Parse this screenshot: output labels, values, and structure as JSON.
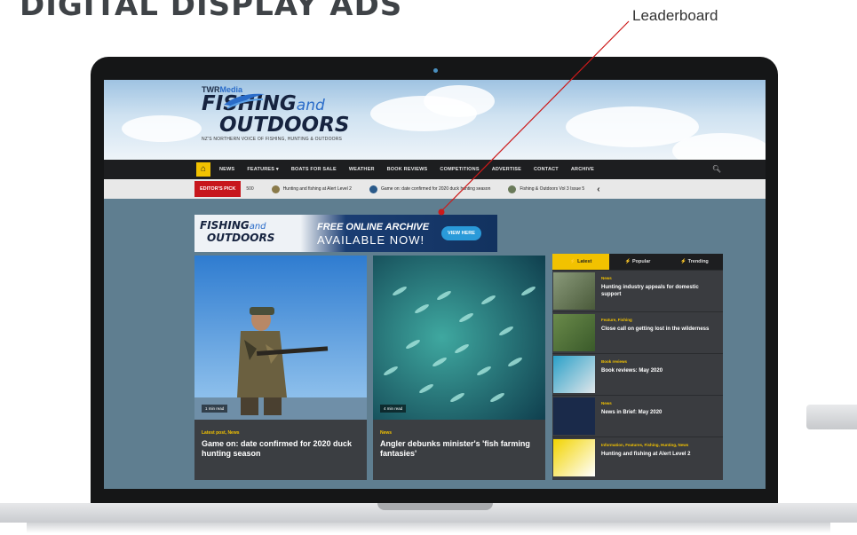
{
  "page": {
    "heading": "DIGITAL DISPLAY ADS",
    "callout_label": "Leaderboard"
  },
  "site": {
    "brand_top": "TWR",
    "brand_top_accent": "Media",
    "logo_line1": "FISHING",
    "logo_and": "and",
    "logo_line2": "OUTDOORS",
    "tagline": "NZ'S NORTHERN VOICE OF FISHING, HUNTING & OUTDOORS"
  },
  "nav": {
    "items": [
      "NEWS",
      "FEATURES ▾",
      "BOATS FOR SALE",
      "WEATHER",
      "BOOK REVIEWS",
      "COMPETITIONS",
      "ADVERTISE",
      "CONTACT",
      "ARCHIVE"
    ],
    "home_icon": "home-icon",
    "search_icon": "search-icon"
  },
  "ticker": {
    "pick_label": "EDITOR'S PICK",
    "tag": "500",
    "items": [
      "Hunting and fishing at Alert Level 2",
      "Game on: date confirmed for 2020 duck hunting season",
      "Fishing & Outdoors Vol 3 Issue 5"
    ]
  },
  "leaderboard": {
    "logo_line1": "FISHING",
    "logo_and": "and",
    "logo_line2": "OUTDOORS",
    "title": "FREE ONLINE ARCHIVE",
    "subtitle": "AVAILABLE NOW!",
    "button": "VIEW HERE"
  },
  "cards": [
    {
      "category": "Latest post, News",
      "title": "Game on: date confirmed for 2020 duck hunting season",
      "read_time": "1 min read"
    },
    {
      "category": "News",
      "title": "Angler debunks minister's 'fish farming fantasies'",
      "read_time": "4 min read"
    }
  ],
  "sidebar": {
    "tabs": [
      "⚡ Latest",
      "⚡ Popular",
      "⚡ Trending"
    ],
    "items": [
      {
        "category": "News",
        "title": "Hunting industry appeals for domestic support"
      },
      {
        "category": "Feature, Fishing",
        "title": "Close call on getting lost in the wilderness"
      },
      {
        "category": "Book reviews",
        "title": "Book reviews: May 2020"
      },
      {
        "category": "News",
        "title": "News in Brief: May 2020"
      },
      {
        "category": "Information, Features, Fishing, Hunting, News",
        "title": "Hunting and fishing at Alert Level 2"
      }
    ]
  },
  "colors": {
    "accent": "#f2c200",
    "nav_bg": "#1d1e20",
    "pick_red": "#c7161c",
    "callout_line": "#cc1a1a"
  }
}
